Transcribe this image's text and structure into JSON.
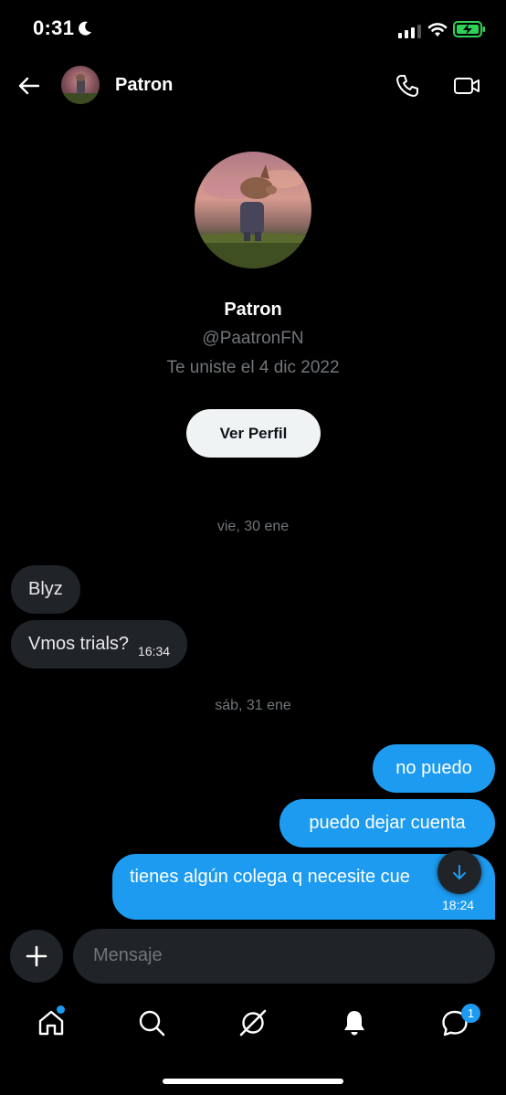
{
  "status_bar": {
    "time": "0:31"
  },
  "header": {
    "name": "Patron"
  },
  "profile": {
    "name": "Patron",
    "handle": "@PaatronFN",
    "joined": "Te uniste el 4 dic 2022",
    "button_label": "Ver Perfil"
  },
  "conversation": {
    "separators": [
      "vie, 30 ene",
      "sáb, 31 ene"
    ],
    "incoming": [
      {
        "text": "Blyz"
      },
      {
        "text": "Vmos trials?",
        "time": "16:34"
      }
    ],
    "outgoing": [
      {
        "text": "no puedo"
      },
      {
        "text": "puedo dejar cuenta"
      },
      {
        "text": "tienes algún colega q necesite cue",
        "time": "18:24"
      }
    ]
  },
  "composer": {
    "placeholder": "Mensaje"
  },
  "tab_bar": {
    "items": [
      "home-icon",
      "search-icon",
      "grok-icon",
      "notifications-icon",
      "messages-icon"
    ],
    "messages_badge": "1"
  },
  "colors": {
    "accent": "#1d9bf0",
    "bubble_in": "#202327",
    "muted": "#71767b",
    "battery": "#30d158"
  }
}
